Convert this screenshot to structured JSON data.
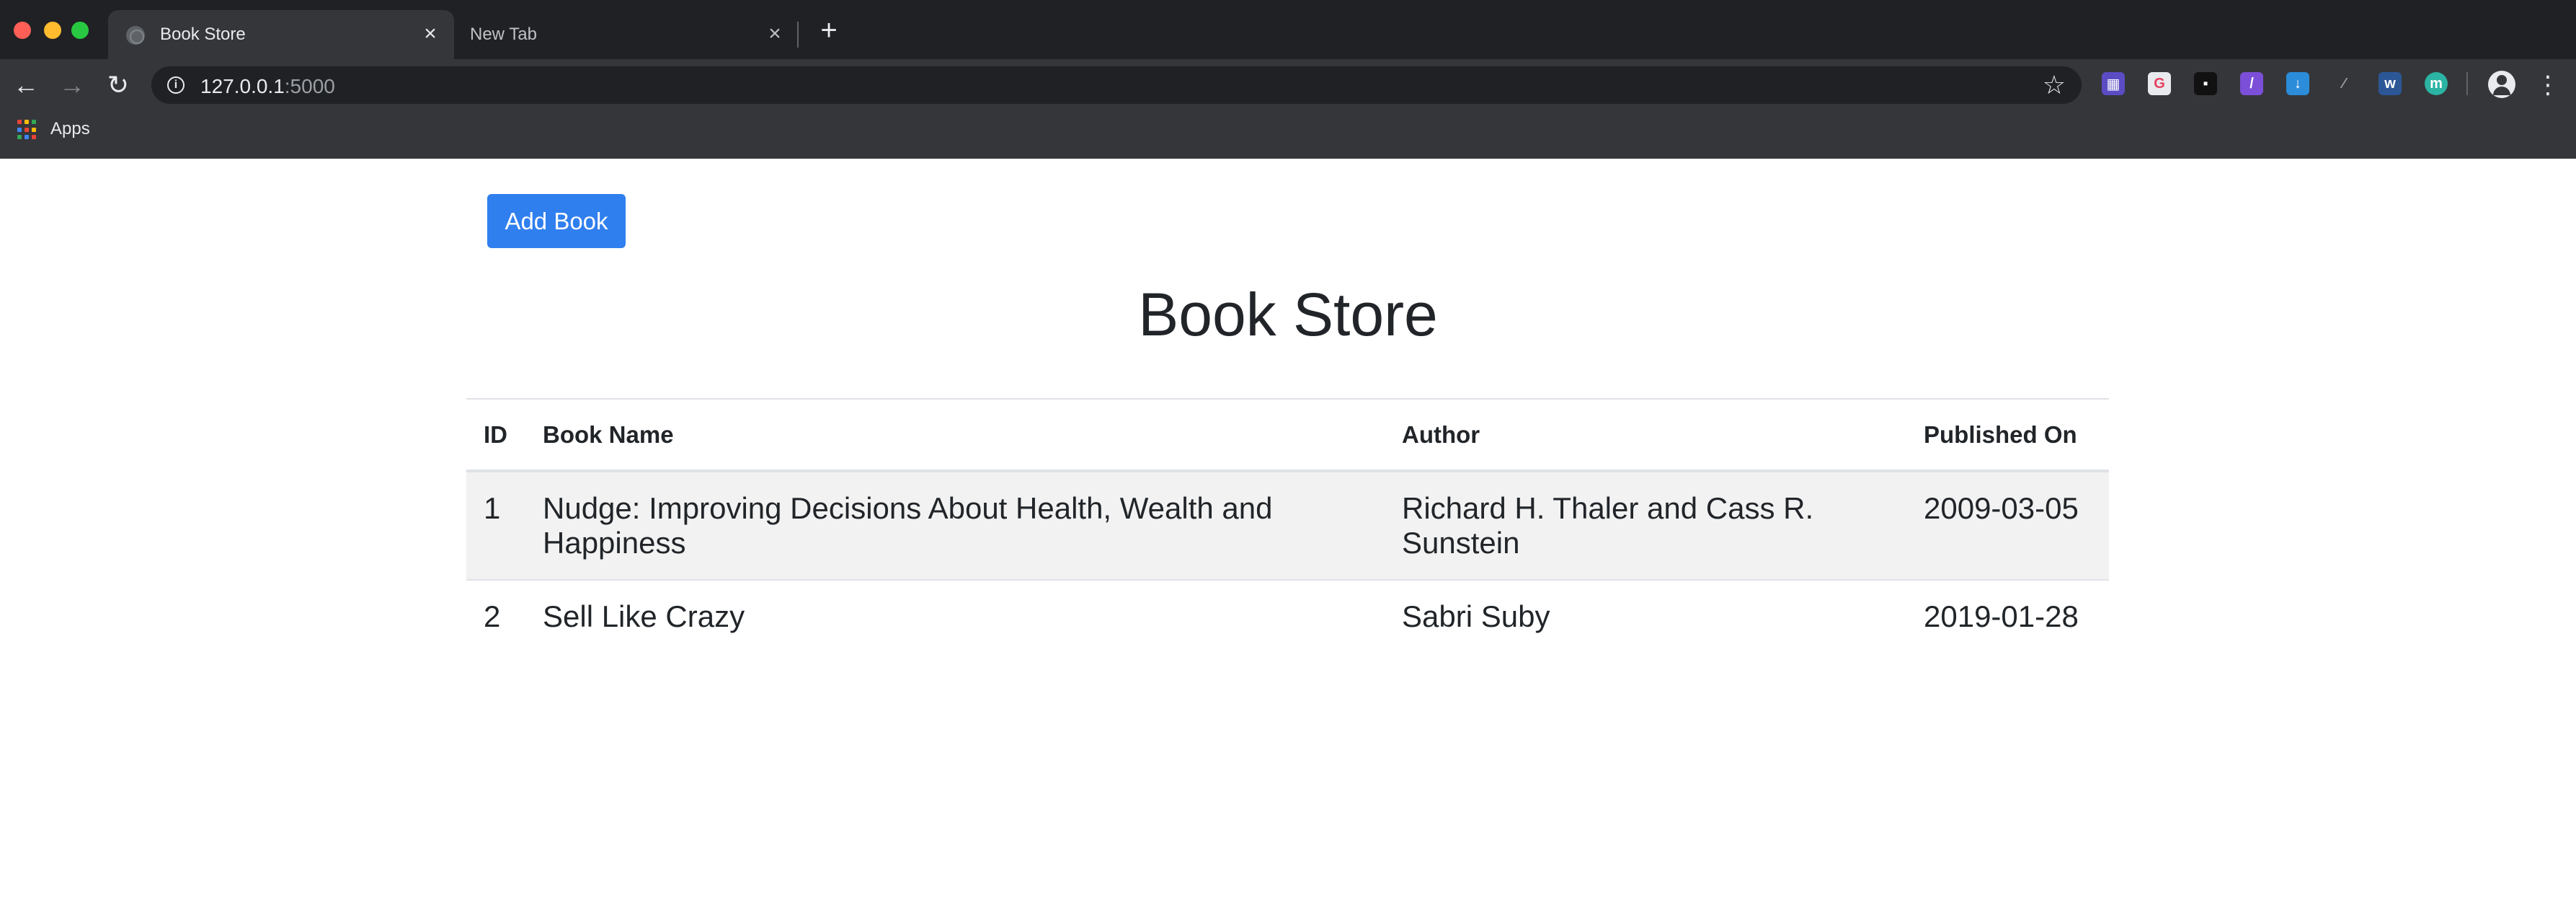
{
  "browser": {
    "tabs": [
      {
        "title": "Book Store",
        "active": true
      },
      {
        "title": "New Tab",
        "active": false
      }
    ],
    "address": {
      "host": "127.0.0.1",
      "port": ":5000"
    },
    "bookmarks": {
      "apps_label": "Apps"
    },
    "extensions": [
      "extension-grid-icon",
      "grammarly-icon",
      "extension-dark-icon",
      "extension-v-icon",
      "download-extension-icon",
      "eyedropper-icon",
      "word-w-icon",
      "extension-m-icon"
    ]
  },
  "page": {
    "add_button_label": "Add Book",
    "title": "Book Store",
    "table": {
      "headers": {
        "id": "ID",
        "name": "Book Name",
        "author": "Author",
        "published": "Published On"
      },
      "rows": [
        {
          "id": "1",
          "name": "Nudge: Improving Decisions About Health, Wealth and Happiness",
          "author": "Richard H. Thaler and Cass R. Sunstein",
          "published": "2009-03-05"
        },
        {
          "id": "2",
          "name": "Sell Like Crazy",
          "author": "Sabri Suby",
          "published": "2019-01-28"
        }
      ]
    }
  },
  "colors": {
    "primary_button": "#2f7fef",
    "striped_row": "#f2f2f2",
    "chrome_dark": "#35363a",
    "tabstrip": "#202124"
  }
}
